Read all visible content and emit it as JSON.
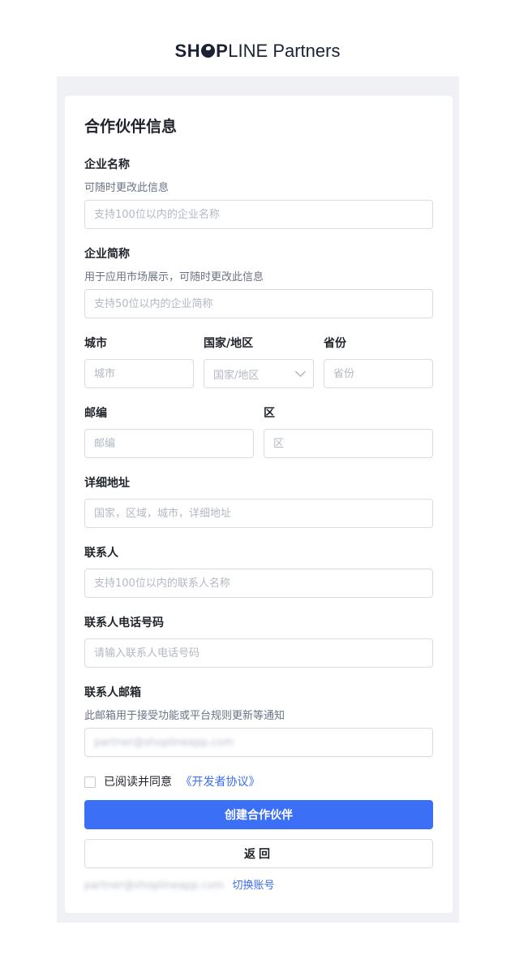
{
  "brand": {
    "bold": "SH",
    "bold2": "P",
    "line": "LINE",
    "partners": " Partners"
  },
  "form": {
    "title": "合作伙伴信息",
    "company_name": {
      "label": "企业名称",
      "hint": "可随时更改此信息",
      "placeholder": "支持100位以内的企业名称",
      "value": ""
    },
    "company_short": {
      "label": "企业简称",
      "hint": "用于应用市场展示，可随时更改此信息",
      "placeholder": "支持50位以内的企业简称",
      "value": ""
    },
    "city": {
      "label": "城市",
      "placeholder": "城市",
      "value": ""
    },
    "country": {
      "label": "国家/地区",
      "selected": "国家/地区",
      "icon": "chevron-down-icon"
    },
    "province": {
      "label": "省份",
      "placeholder": "省份",
      "value": ""
    },
    "zip": {
      "label": "邮编",
      "placeholder": "邮编",
      "value": ""
    },
    "district": {
      "label": "区",
      "placeholder": "区",
      "value": ""
    },
    "address": {
      "label": "详细地址",
      "placeholder": "国家，区域，城市，详细地址",
      "value": ""
    },
    "contact": {
      "label": "联系人",
      "placeholder": "支持100位以内的联系人名称",
      "value": ""
    },
    "phone": {
      "label": "联系人电话号码",
      "placeholder": "请输入联系人电话号码",
      "value": ""
    },
    "email": {
      "label": "联系人邮箱",
      "hint": "此邮箱用于接受功能或平台规则更新等通知",
      "value": "partner@shoplineapp.com"
    },
    "agreement": {
      "text": "已阅读并同意",
      "link": "《开发者协议》",
      "checked": false
    },
    "submit_label": "创建合作伙伴",
    "back_label": "返回"
  },
  "footer": {
    "account_email": "partner@shoplineapp.com",
    "switch_label": "切换账号"
  },
  "colors": {
    "primary": "#3b6ff6",
    "link": "#3a6cf4",
    "background": "#f0f1f4"
  }
}
